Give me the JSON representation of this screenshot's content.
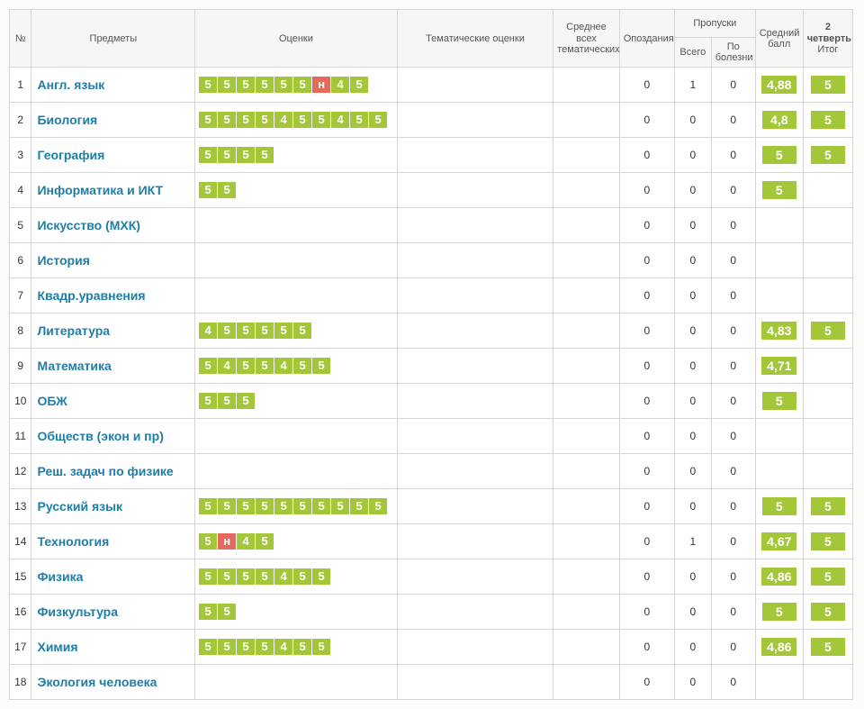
{
  "headers": {
    "num": "№",
    "subjects": "Предметы",
    "grades": "Оценки",
    "thematic": "Тематические оценки",
    "avg_thematic_line1": "Среднее всех",
    "avg_thematic_line2": "тематических",
    "lates": "Опоздания",
    "absences": "Пропуски",
    "abs_total": "Всего",
    "abs_ill_line1": "По",
    "abs_ill_line2": "болезни",
    "avg_score_line1": "Средний",
    "avg_score_line2": "балл",
    "quarter_line1": "2",
    "quarter_line2": "четверть",
    "quarter_line3": "Итог"
  },
  "rows": [
    {
      "n": "1",
      "subject": "Англ. язык",
      "grades": [
        [
          "5",
          0
        ],
        [
          "5",
          0
        ],
        [
          "5",
          0
        ],
        [
          "5",
          0
        ],
        [
          "5",
          0
        ],
        [
          "5",
          0
        ],
        [
          "н",
          1
        ],
        [
          "4",
          0
        ],
        [
          "5",
          0
        ]
      ],
      "late": "0",
      "abs_total": "1",
      "abs_ill": "0",
      "avg": "4,88",
      "itog": "5"
    },
    {
      "n": "2",
      "subject": "Биология",
      "grades": [
        [
          "5",
          0
        ],
        [
          "5",
          0
        ],
        [
          "5",
          0
        ],
        [
          "5",
          0
        ],
        [
          "4",
          0
        ],
        [
          "5",
          0
        ],
        [
          "5",
          0
        ],
        [
          "4",
          0
        ],
        [
          "5",
          0
        ],
        [
          "5",
          0
        ]
      ],
      "late": "0",
      "abs_total": "0",
      "abs_ill": "0",
      "avg": "4,8",
      "itog": "5"
    },
    {
      "n": "3",
      "subject": "География",
      "grades": [
        [
          "5",
          0
        ],
        [
          "5",
          0
        ],
        [
          "5",
          0
        ],
        [
          "5",
          0
        ]
      ],
      "late": "0",
      "abs_total": "0",
      "abs_ill": "0",
      "avg": "5",
      "itog": "5"
    },
    {
      "n": "4",
      "subject": "Информатика и ИКТ",
      "grades": [
        [
          "5",
          0
        ],
        [
          "5",
          0
        ]
      ],
      "late": "0",
      "abs_total": "0",
      "abs_ill": "0",
      "avg": "5",
      "itog": ""
    },
    {
      "n": "5",
      "subject": "Искусство (МХК)",
      "grades": [],
      "late": "0",
      "abs_total": "0",
      "abs_ill": "0",
      "avg": "",
      "itog": ""
    },
    {
      "n": "6",
      "subject": "История",
      "grades": [],
      "late": "0",
      "abs_total": "0",
      "abs_ill": "0",
      "avg": "",
      "itog": ""
    },
    {
      "n": "7",
      "subject": "Квадр.уравнения",
      "grades": [],
      "late": "0",
      "abs_total": "0",
      "abs_ill": "0",
      "avg": "",
      "itog": ""
    },
    {
      "n": "8",
      "subject": "Литература",
      "grades": [
        [
          "4",
          0
        ],
        [
          "5",
          0
        ],
        [
          "5",
          0
        ],
        [
          "5",
          0
        ],
        [
          "5",
          0
        ],
        [
          "5",
          0
        ]
      ],
      "late": "0",
      "abs_total": "0",
      "abs_ill": "0",
      "avg": "4,83",
      "itog": "5"
    },
    {
      "n": "9",
      "subject": "Математика",
      "grades": [
        [
          "5",
          0
        ],
        [
          "4",
          0
        ],
        [
          "5",
          0
        ],
        [
          "5",
          0
        ],
        [
          "4",
          0
        ],
        [
          "5",
          0
        ],
        [
          "5",
          0
        ]
      ],
      "late": "0",
      "abs_total": "0",
      "abs_ill": "0",
      "avg": "4,71",
      "itog": ""
    },
    {
      "n": "10",
      "subject": "ОБЖ",
      "grades": [
        [
          "5",
          0
        ],
        [
          "5",
          0
        ],
        [
          "5",
          0
        ]
      ],
      "late": "0",
      "abs_total": "0",
      "abs_ill": "0",
      "avg": "5",
      "itog": ""
    },
    {
      "n": "11",
      "subject": "Обществ (экон и пр)",
      "grades": [],
      "late": "0",
      "abs_total": "0",
      "abs_ill": "0",
      "avg": "",
      "itog": ""
    },
    {
      "n": "12",
      "subject": "Реш. задач по физике",
      "grades": [],
      "late": "0",
      "abs_total": "0",
      "abs_ill": "0",
      "avg": "",
      "itog": ""
    },
    {
      "n": "13",
      "subject": "Русский язык",
      "grades": [
        [
          "5",
          0
        ],
        [
          "5",
          0
        ],
        [
          "5",
          0
        ],
        [
          "5",
          0
        ],
        [
          "5",
          0
        ],
        [
          "5",
          0
        ],
        [
          "5",
          0
        ],
        [
          "5",
          0
        ],
        [
          "5",
          0
        ],
        [
          "5",
          0
        ]
      ],
      "late": "0",
      "abs_total": "0",
      "abs_ill": "0",
      "avg": "5",
      "itog": "5"
    },
    {
      "n": "14",
      "subject": "Технология",
      "grades": [
        [
          "5",
          0
        ],
        [
          "н",
          1
        ],
        [
          "4",
          0
        ],
        [
          "5",
          0
        ]
      ],
      "late": "0",
      "abs_total": "1",
      "abs_ill": "0",
      "avg": "4,67",
      "itog": "5"
    },
    {
      "n": "15",
      "subject": "Физика",
      "grades": [
        [
          "5",
          0
        ],
        [
          "5",
          0
        ],
        [
          "5",
          0
        ],
        [
          "5",
          0
        ],
        [
          "4",
          0
        ],
        [
          "5",
          0
        ],
        [
          "5",
          0
        ]
      ],
      "late": "0",
      "abs_total": "0",
      "abs_ill": "0",
      "avg": "4,86",
      "itog": "5"
    },
    {
      "n": "16",
      "subject": "Физкультура",
      "grades": [
        [
          "5",
          0
        ],
        [
          "5",
          0
        ]
      ],
      "late": "0",
      "abs_total": "0",
      "abs_ill": "0",
      "avg": "5",
      "itog": "5"
    },
    {
      "n": "17",
      "subject": "Химия",
      "grades": [
        [
          "5",
          0
        ],
        [
          "5",
          0
        ],
        [
          "5",
          0
        ],
        [
          "5",
          0
        ],
        [
          "4",
          0
        ],
        [
          "5",
          0
        ],
        [
          "5",
          0
        ]
      ],
      "late": "0",
      "abs_total": "0",
      "abs_ill": "0",
      "avg": "4,86",
      "itog": "5"
    },
    {
      "n": "18",
      "subject": "Экология человека",
      "grades": [],
      "late": "0",
      "abs_total": "0",
      "abs_ill": "0",
      "avg": "",
      "itog": ""
    }
  ]
}
